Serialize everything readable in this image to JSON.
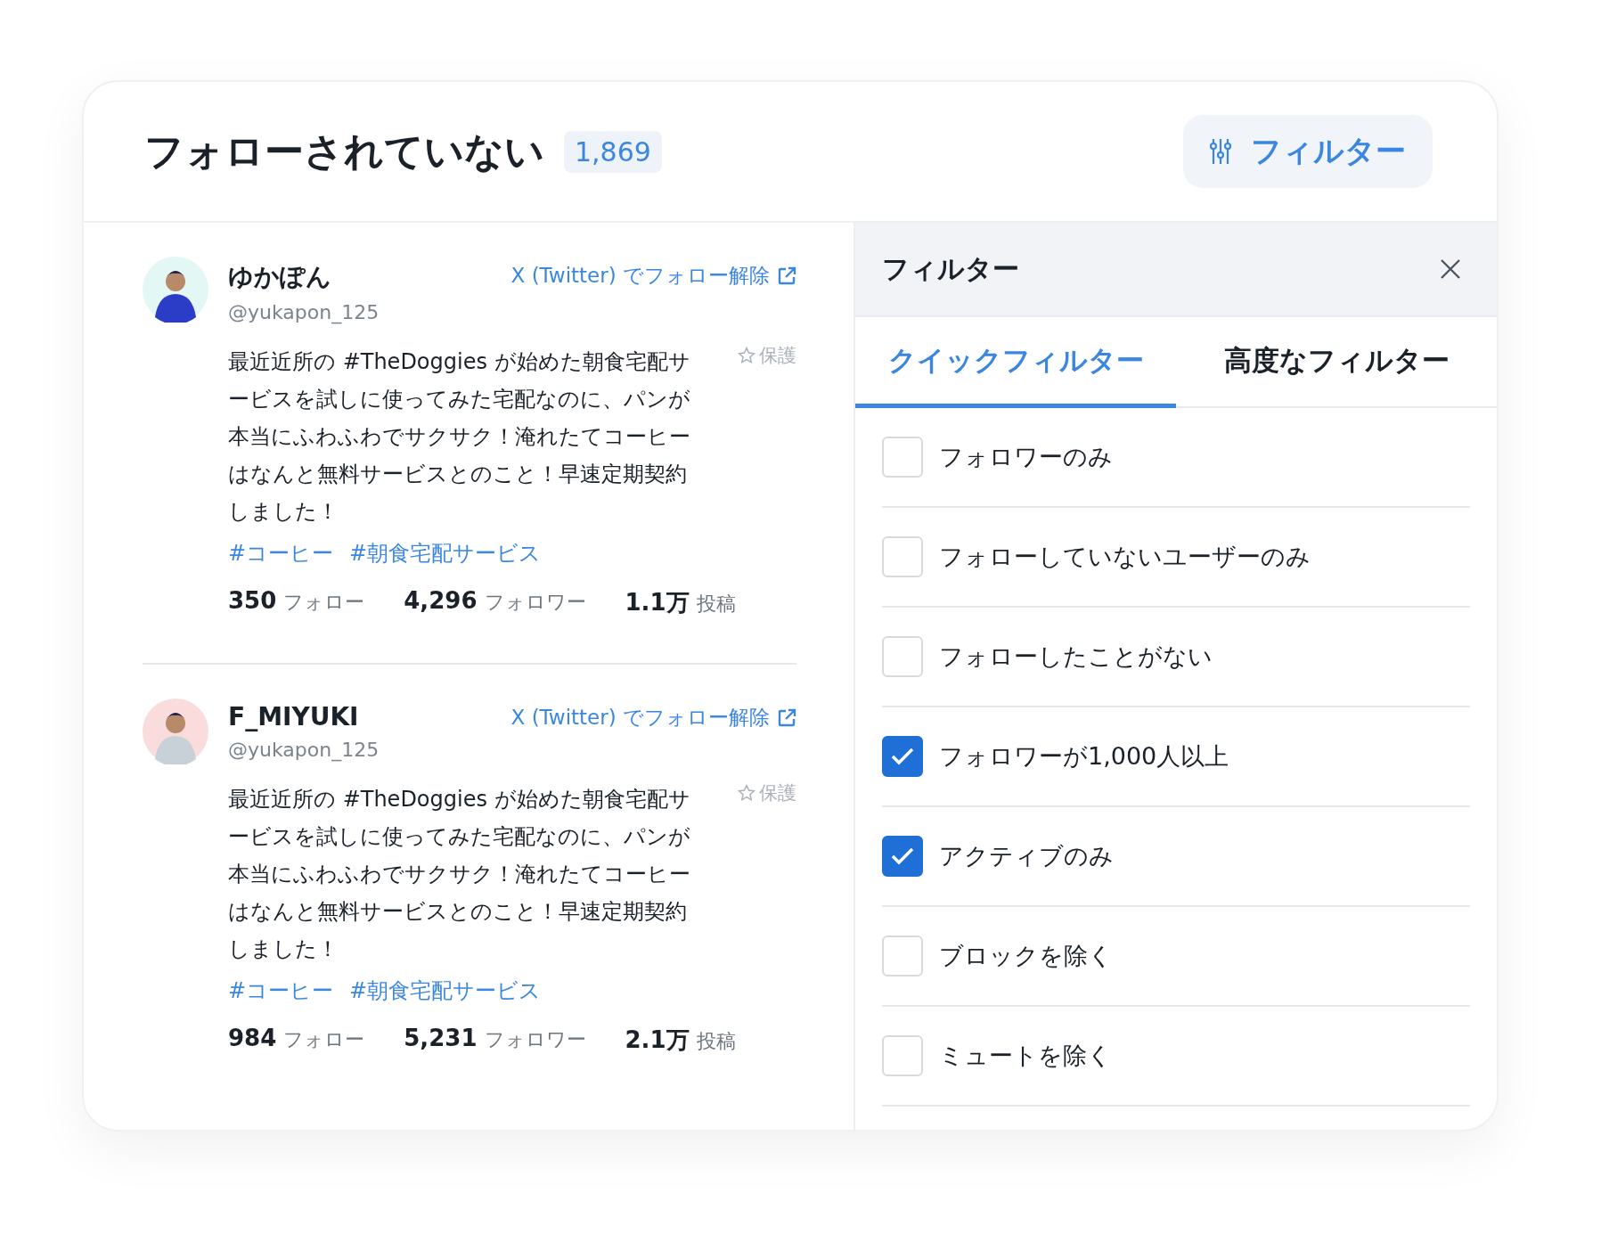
{
  "header": {
    "title": "フォローされていない",
    "count": "1,869",
    "filter_button": "フィルター"
  },
  "users": [
    {
      "name": "ゆかぽん",
      "handle": "@yukapon_125",
      "unfollow_link": "X (Twitter) でフォロー解除",
      "protect": "保護",
      "body": "最近近所の #TheDoggies が始めた朝食宅配サービスを試しに使ってみた宅配なのに、パンが本当にふわふわでサクサク！淹れたてコーヒーはなんと無料サービスとのこと！早速定期契約しました！",
      "tags": [
        "#コーヒー",
        "#朝食宅配サービス"
      ],
      "stats": [
        {
          "value": "350",
          "label": "フォロー"
        },
        {
          "value": "4,296",
          "label": "フォロワー"
        },
        {
          "value": "1.1万",
          "label": "投稿"
        }
      ]
    },
    {
      "name": "F_MIYUKI",
      "handle": "@yukapon_125",
      "unfollow_link": "X (Twitter) でフォロー解除",
      "protect": "保護",
      "body": "最近近所の #TheDoggies が始めた朝食宅配サービスを試しに使ってみた宅配なのに、パンが本当にふわふわでサクサク！淹れたてコーヒーはなんと無料サービスとのこと！早速定期契約しました！",
      "tags": [
        "#コーヒー",
        "#朝食宅配サービス"
      ],
      "stats": [
        {
          "value": "984",
          "label": "フォロー"
        },
        {
          "value": "5,231",
          "label": "フォロワー"
        },
        {
          "value": "2.1万",
          "label": "投稿"
        }
      ]
    }
  ],
  "filter_panel": {
    "title": "フィルター",
    "tabs": [
      {
        "label": "クイックフィルター",
        "selected": true
      },
      {
        "label": "高度なフィルター",
        "selected": false
      }
    ],
    "options": [
      {
        "label": "フォロワーのみ",
        "checked": false
      },
      {
        "label": "フォローしていないユーザーのみ",
        "checked": false
      },
      {
        "label": "フォローしたことがない",
        "checked": false
      },
      {
        "label": "フォロワーが1,000人以上",
        "checked": true
      },
      {
        "label": "アクティブのみ",
        "checked": true
      },
      {
        "label": "ブロックを除く",
        "checked": false
      },
      {
        "label": "ミュートを除く",
        "checked": false
      }
    ]
  }
}
